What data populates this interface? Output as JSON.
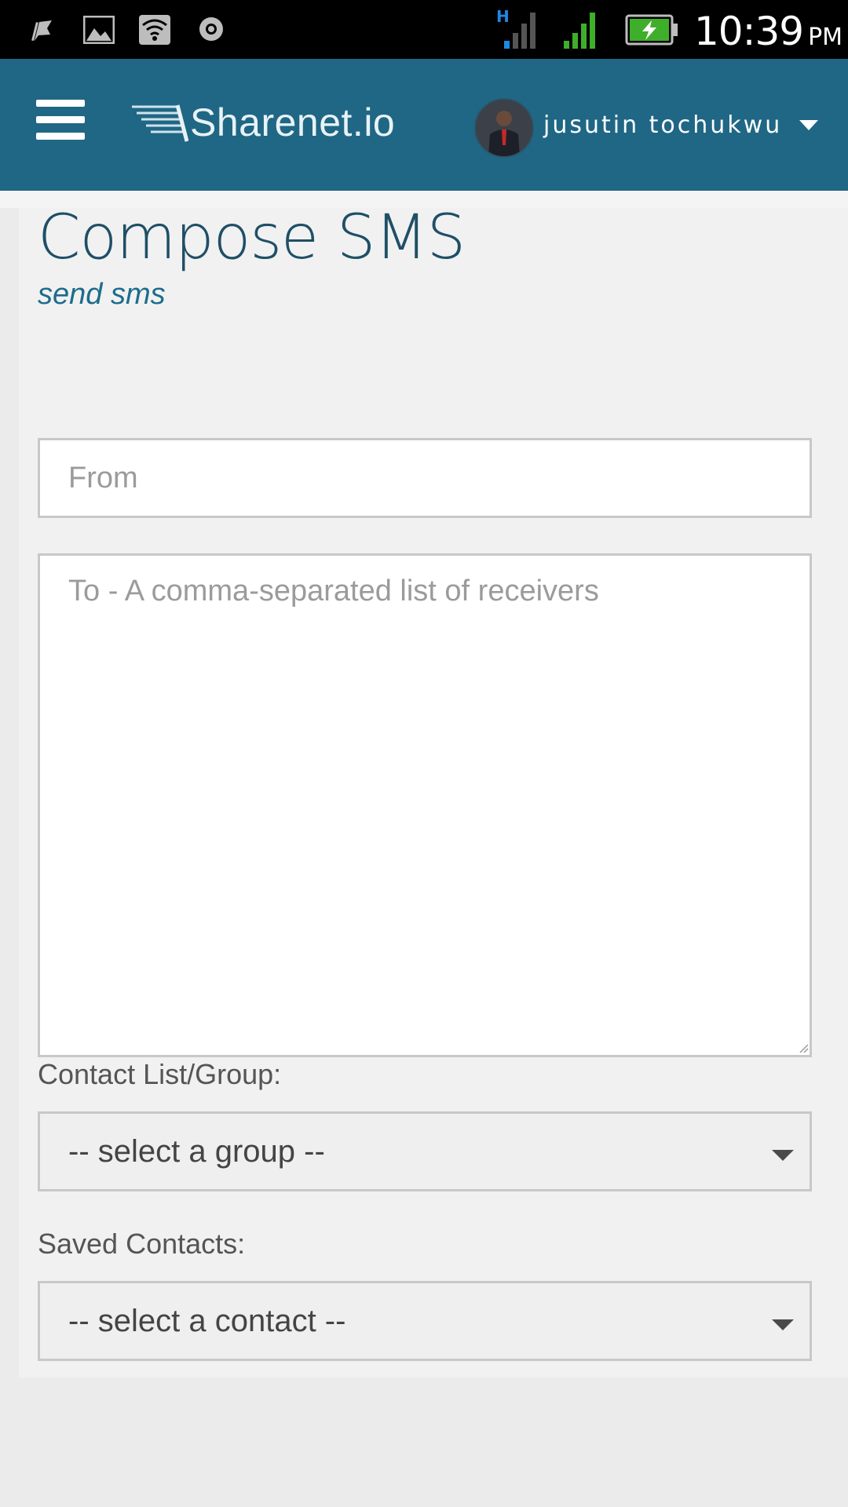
{
  "status_bar": {
    "notification_icons": [
      "flag-icon",
      "image-icon",
      "wifi-icon",
      "record-icon"
    ],
    "network_type": "H",
    "time": "10:39",
    "ampm": "PM"
  },
  "header": {
    "logo_text": "Sharenet.io",
    "username": "jusutin tochukwu",
    "colors": {
      "bar": "#1f6785",
      "logo": "#e9f2f6"
    }
  },
  "page": {
    "title": "Compose SMS",
    "subtitle": "send sms"
  },
  "form": {
    "from_placeholder": "From",
    "from_value": "",
    "to_placeholder": "To - A comma-separated list of receivers",
    "to_value": "",
    "group_label": "Contact List/Group:",
    "group_selected": "-- select a group --",
    "contacts_label": "Saved Contacts:",
    "contact_selected": "-- select a contact --"
  },
  "colors": {
    "title": "#1f4f66",
    "subtitle": "#1d6c8c",
    "battery": "#3fae2a",
    "signal_active": "#3fae2a",
    "network_indicator": "#1e88e5"
  }
}
